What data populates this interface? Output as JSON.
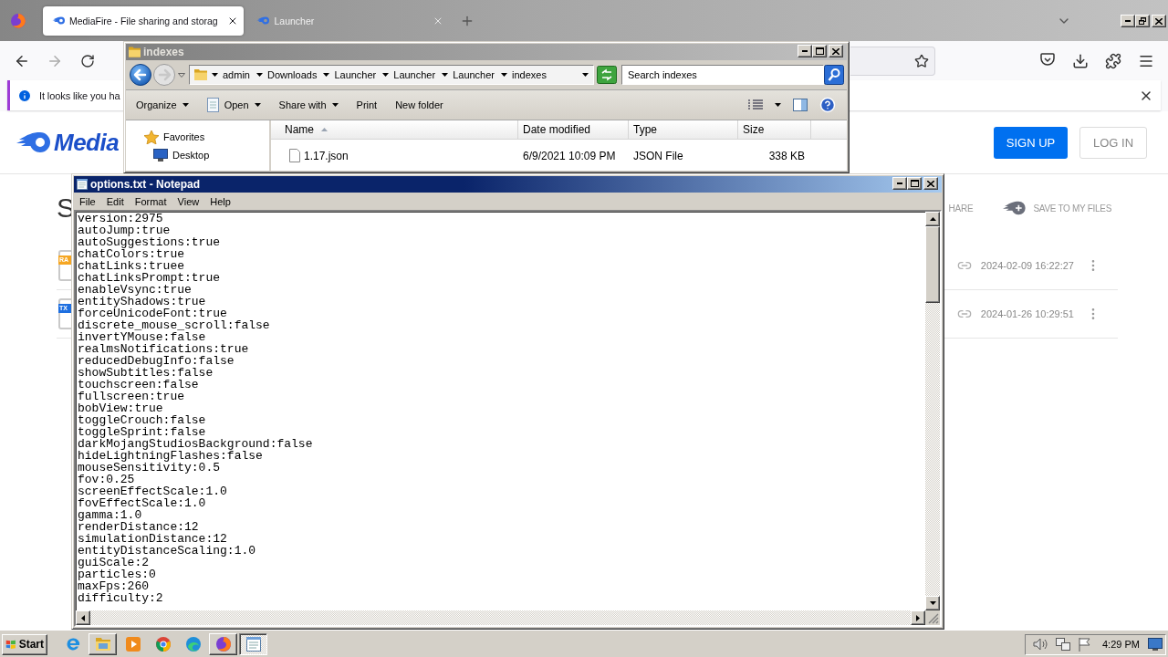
{
  "browser": {
    "tabs": [
      {
        "title": "MediaFire - File sharing and storag",
        "selected": true
      },
      {
        "title": "Launcher",
        "selected": false
      }
    ],
    "notification": {
      "text": "It looks like you ha"
    },
    "page": {
      "logo_text": "Media",
      "header_buttons": [
        {
          "label": "SIGN UP",
          "kind": "primary"
        },
        {
          "label": "LOG IN",
          "kind": "outline"
        }
      ],
      "heading": "S",
      "actions": [
        {
          "label": "HARE",
          "kind": "text"
        },
        {
          "label": "SAVE TO MY FILES",
          "kind": "save"
        }
      ],
      "files": [
        {
          "badge": "RA",
          "color": "#f5a623",
          "date": "2024-02-09 16:22:27"
        },
        {
          "badge": "TX",
          "color": "#1e6fe0",
          "date": "2024-01-26 10:29:51"
        }
      ]
    }
  },
  "explorer": {
    "title": "indexes",
    "active": false,
    "breadcrumb": [
      "admin",
      "Downloads",
      "Launcher",
      "Launcher",
      "Launcher",
      "indexes"
    ],
    "search": {
      "placeholder": "Search indexes"
    },
    "toolbar": [
      {
        "label": "Organize",
        "kind": "menu"
      },
      {
        "label": "Open",
        "kind": "split"
      },
      {
        "label": "Share with",
        "kind": "menu"
      },
      {
        "label": "Print",
        "kind": "plain"
      },
      {
        "label": "New folder",
        "kind": "plain"
      }
    ],
    "navigation": [
      {
        "label": "Favorites",
        "children": [
          {
            "label": "Desktop"
          }
        ]
      }
    ],
    "columns": [
      {
        "label": "Name",
        "sorted": true
      },
      {
        "label": "Date modified",
        "sorted": false
      },
      {
        "label": "Type",
        "sorted": false
      },
      {
        "label": "Size",
        "sorted": false
      }
    ],
    "files": [
      {
        "name": "1.17.json",
        "date_modified": "6/9/2021 10:09 PM",
        "type": "JSON File",
        "size": "338 KB"
      }
    ]
  },
  "notepad": {
    "title": "options.txt - Notepad",
    "active": true,
    "menu": [
      "File",
      "Edit",
      "Format",
      "View",
      "Help"
    ],
    "lines": [
      "version:2975",
      "autoJump:true",
      "autoSuggestions:true",
      "chatColors:true",
      "chatLinks:truee",
      "chatLinksPrompt:true",
      "enableVsync:true",
      "entityShadows:true",
      "forceUnicodeFont:true",
      "discrete_mouse_scroll:false",
      "invertYMouse:false",
      "realmsNotifications:true",
      "reducedDebugInfo:false",
      "showSubtitles:false",
      "touchscreen:false",
      "fullscreen:true",
      "bobView:true",
      "toggleCrouch:false",
      "toggleSprint:false",
      "darkMojangStudiosBackground:false",
      "hideLightningFlashes:false",
      "mouseSensitivity:0.5",
      "fov:0.25",
      "screenEffectScale:1.0",
      "fovEffectScale:1.0",
      "gamma:1.0",
      "renderDistance:12",
      "simulationDistance:12",
      "entityDistanceScaling:1.0",
      "guiScale:2",
      "particles:0",
      "maxFps:260",
      "difficulty:2"
    ]
  },
  "taskbar": {
    "start": "Start",
    "items": [
      {
        "running": false,
        "selected": false
      },
      {
        "running": true,
        "selected": false
      },
      {
        "running": false,
        "selected": false
      },
      {
        "running": false,
        "selected": false
      },
      {
        "running": false,
        "selected": false
      },
      {
        "running": true,
        "selected": false
      },
      {
        "running": true,
        "selected": true
      }
    ],
    "clock": "4:29 PM"
  }
}
